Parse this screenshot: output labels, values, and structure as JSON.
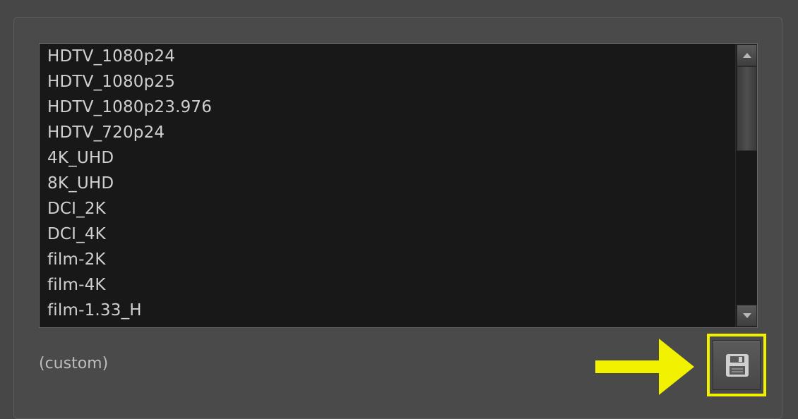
{
  "formats": {
    "items": [
      "HDTV_1080p24",
      "HDTV_1080p25",
      "HDTV_1080p23.976",
      "HDTV_720p24",
      "4K_UHD",
      "8K_UHD",
      "DCI_2K",
      "DCI_4K",
      "film-2K",
      "film-4K",
      "film-1.33_H"
    ]
  },
  "footer": {
    "custom_label": "(custom)",
    "save_icon": "floppy-disk-icon"
  },
  "colors": {
    "highlight": "#f2f200",
    "list_background": "#181818",
    "panel_background": "#4a4a4a"
  }
}
